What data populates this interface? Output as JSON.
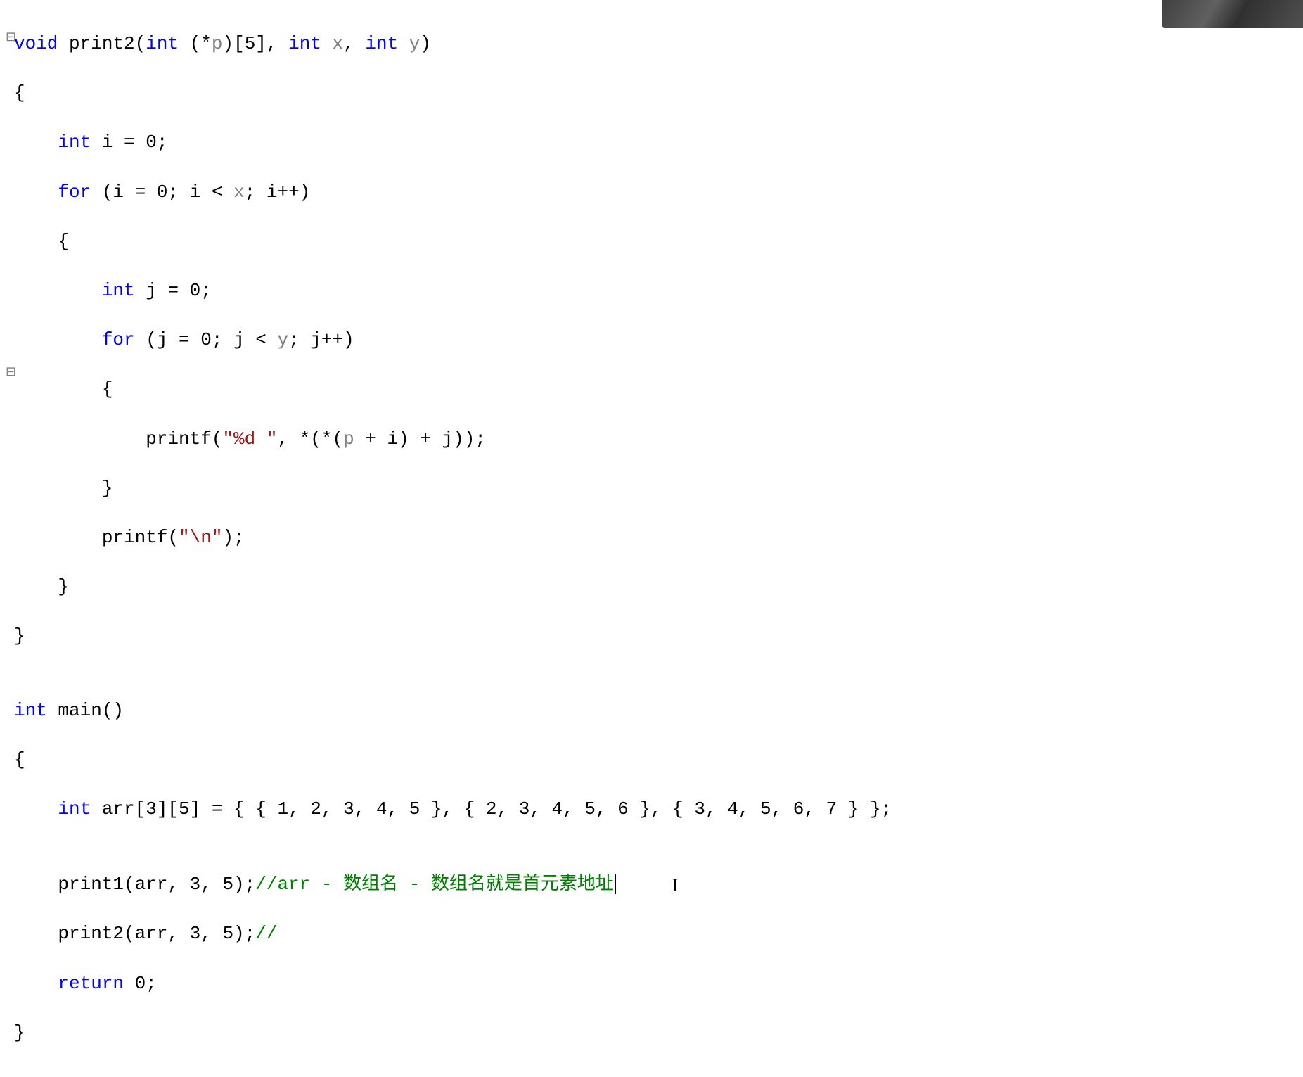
{
  "code": {
    "fn1_sig_prefix": "void",
    "fn1_name": " print2(",
    "fn1_param1_kw": "int",
    "fn1_param1_id": " (*",
    "fn1_param1_p": "p",
    "fn1_param1_arr": ")[5], ",
    "fn1_param2_kw": "int",
    "fn1_param2_sp": " ",
    "fn1_param2_p": "x",
    "fn1_param2_comma": ", ",
    "fn1_param3_kw": "int",
    "fn1_param3_sp": " ",
    "fn1_param3_p": "y",
    "fn1_sig_close": ")",
    "brace_open": "{",
    "decl_i_kw": "    int",
    "decl_i_rest": " i = 0;",
    "for_i_kw": "    for",
    "for_i_open": " (i = 0; i < ",
    "for_i_x": "x",
    "for_i_rest": "; i++)",
    "brace_open2": "    {",
    "decl_j_kw": "        int",
    "decl_j_rest": " j = 0;",
    "for_j_kw": "        for",
    "for_j_open": " (j = 0; j < ",
    "for_j_y": "y",
    "for_j_rest": "; j++)",
    "brace_open3": "        {",
    "printf1_pre": "            printf(",
    "printf1_str": "\"%d \"",
    "printf1_mid": ", *(*(",
    "printf1_p": "p",
    "printf1_rest": " + i) + j));",
    "brace_close3": "        }",
    "printf2_pre": "        printf(",
    "printf2_str": "\"\\n\"",
    "printf2_close": ");",
    "brace_close2": "    }",
    "brace_close1": "}",
    "blank": "",
    "main_kw": "int",
    "main_rest": " main()",
    "arr_kw": "    int",
    "arr_decl": " arr[3][5] = { { 1, 2, 3, 4, 5 }, { 2, 3, 4, 5, 6 }, { 3, 4, 5, 6, 7 } };",
    "call1_pre": "    print1(arr, 3, 5);",
    "call1_comment": "//arr - 数组名 - 数组名就是首元素地址",
    "call2_pre": "    print2(arr, 3, 5);",
    "call2_comment": "//",
    "return_kw": "    return",
    "return_rest": " 0;",
    "cursor_glyph": "I"
  }
}
